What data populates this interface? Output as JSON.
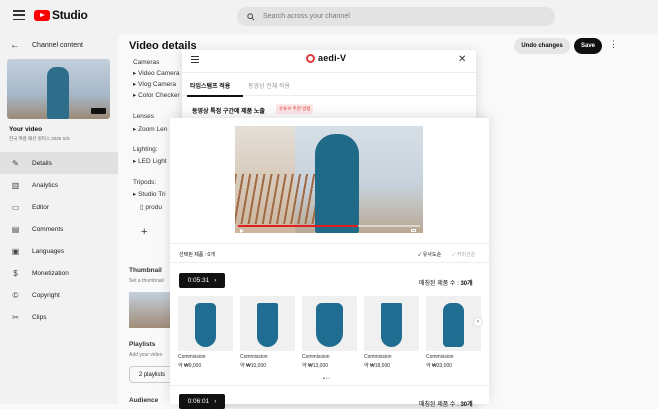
{
  "topbar": {
    "logo_text": "Studio",
    "search_placeholder": "Search across your channel"
  },
  "sidebar": {
    "title": "Channel content",
    "your_video": "Your video",
    "video_title": "한국 여름 패션 원피스 2025 S/S",
    "items": [
      {
        "label": "Details",
        "icon": "pencil-icon",
        "active": true
      },
      {
        "label": "Analytics",
        "icon": "analytics-icon"
      },
      {
        "label": "Editor",
        "icon": "editor-icon"
      },
      {
        "label": "Comments",
        "icon": "comments-icon"
      },
      {
        "label": "Languages",
        "icon": "languages-icon"
      },
      {
        "label": "Monetization",
        "icon": "dollar-icon"
      },
      {
        "label": "Copyright",
        "icon": "copyright-icon"
      },
      {
        "label": "Clips",
        "icon": "scissors-icon"
      }
    ]
  },
  "header": {
    "title": "Video details",
    "undo": "Undo changes",
    "save": "Save"
  },
  "background": {
    "cameras": "Cameras",
    "cam1": "▸ Video Camera",
    "cam2": "▸ Vlog Camera",
    "cam3": "▸ Color Checker",
    "lenses": "Lenses",
    "lens1": "▸ Zoom Len",
    "lighting": "Lighting:",
    "light1": "▸ LED Light",
    "tripods": "Tripods:",
    "tripod1": "▸ Studio Tri",
    "product": "produ",
    "plus": "+",
    "thumbnail": "Thumbnail",
    "thumbnail_desc": "Set a thumbnail",
    "playlists": "Playlists",
    "playlists_desc": "Add your video",
    "playlists_pill": "2 playlists",
    "audience": "Audience"
  },
  "aedi": {
    "logo": "aedi-V",
    "tab1": "타임스탬프 적용",
    "tab2": "동영상 전체 적용",
    "section_title": "동영상 특정 구간에 제품 노출",
    "badge": "유튜브 추천 방법"
  },
  "panel": {
    "selected": "선택된 제품 : 0개",
    "sort1": "✓ 유사도순",
    "sort2": "✓ 커미션순",
    "timestamp1": "0:05:31",
    "timestamp2": "0:06:01",
    "match_label": "매칭된 제품 수 : ",
    "match_count": "30개",
    "products": [
      {
        "name": "Commission",
        "price": "약 ₩9,000"
      },
      {
        "name": "Commission",
        "price": "약 ₩10,000"
      },
      {
        "name": "Commission",
        "price": "약 ₩13,000"
      },
      {
        "name": "Commission",
        "price": "약 ₩18,000"
      },
      {
        "name": "Commission",
        "price": "약 ₩33,000"
      }
    ]
  }
}
